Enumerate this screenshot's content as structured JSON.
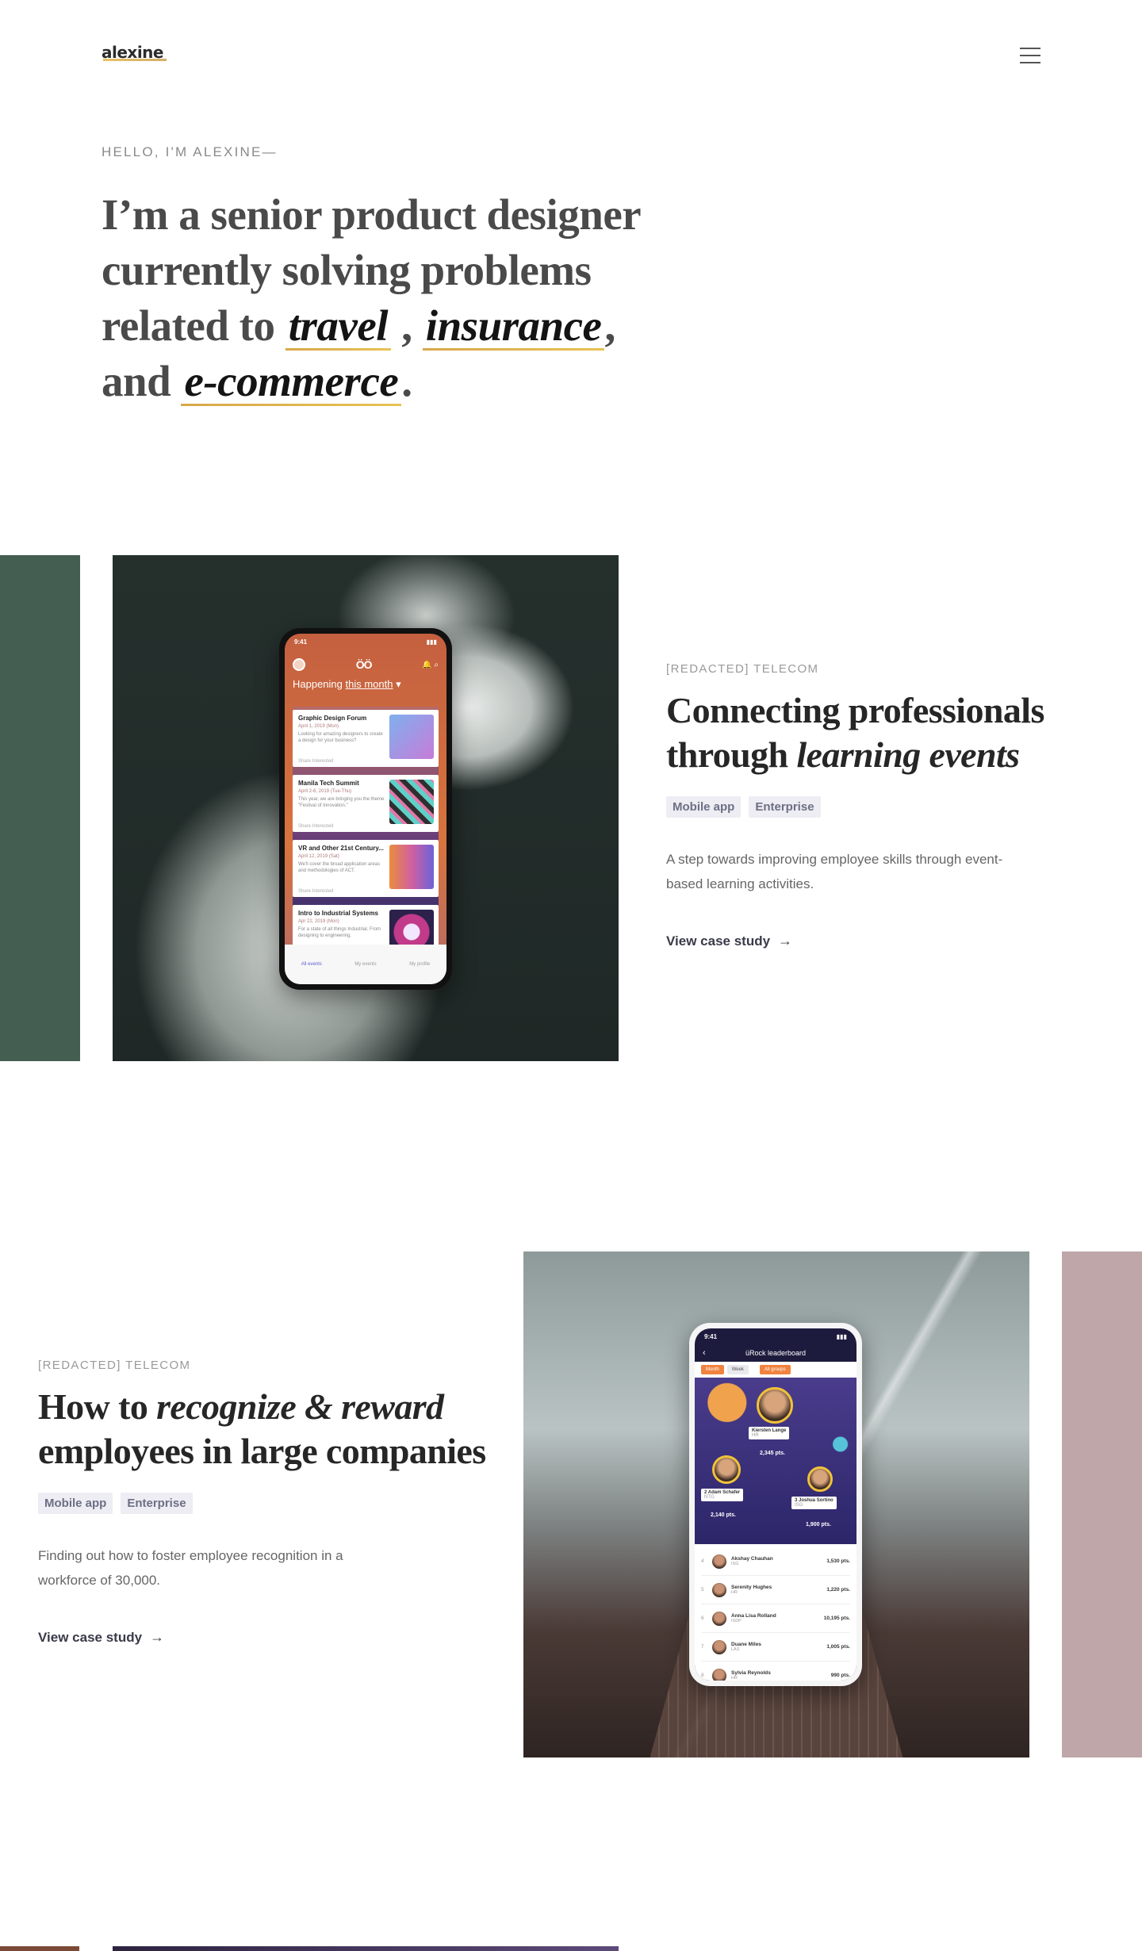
{
  "header": {
    "logo": "alexine",
    "menu_icon": "hamburger-menu-icon"
  },
  "hero": {
    "eyebrow": "HELLO, I'M ALEXINE—",
    "line1": "I’m a senior product designer",
    "line2": "currently solving problems",
    "line3_prefix": "related to ",
    "kw1": "travel",
    "sep1": " , ",
    "kw2": "insurance",
    "sep2": ",",
    "line4_prefix": "and ",
    "kw3": "e-commerce",
    "end": "."
  },
  "cases": [
    {
      "company": "[REDACTED] TELECOM",
      "title_line1": "Connecting professionals",
      "title_line2_plain": "through ",
      "title_line2_em": "learning events",
      "tags": [
        "Mobile app",
        "Enterprise"
      ],
      "description": "A step towards improving employee skills through event-based learning activities.",
      "cta": "View case study",
      "side_color": "#445e52",
      "phone": {
        "time": "9:41",
        "brand": "ÖÖ",
        "heading_prefix": "Happening ",
        "heading_filter": "this month",
        "events": [
          {
            "title": "Graphic Design Forum",
            "meta": "April 1, 2019 (Mon)",
            "text": "Looking for amazing designers to create a design for your business?"
          },
          {
            "title": "Manila Tech Summit",
            "meta": "April 2-6, 2019 (Tue-Thu)",
            "text": "This year, we are bringing you the theme \"Festival of Innovation.\""
          },
          {
            "title": "VR and Other 21st Century...",
            "meta": "April 12, 2019 (Sat)",
            "text": "We'll cover the broad application areas and methodologies of ACT."
          },
          {
            "title": "Intro to Industrial Systems",
            "meta": "Apr 22, 2019 (Mon)",
            "text": "For a state of all things Industrial. From designing to engineering."
          }
        ],
        "actions": "Share    Interested",
        "tabs": [
          "All events",
          "My events",
          "My profile"
        ]
      }
    },
    {
      "company": "[REDACTED] TELECOM",
      "title_line1_plain": "How to ",
      "title_line1_em": "recognize & reward",
      "title_line2": "employees in large companies",
      "tags": [
        "Mobile app",
        "Enterprise"
      ],
      "description_line1": "Finding out how to foster employee recognition in a",
      "description_line2": "workforce of 30,000.",
      "cta": "View case study",
      "side_color": "#bfa6a8",
      "phone": {
        "time": "9:41",
        "title": "üRock leaderboard",
        "filters": [
          "Month",
          "Week",
          "All groups"
        ],
        "podium": [
          {
            "name": "Kiersten Lange",
            "group": "HR",
            "pts": "2,345 pts."
          },
          {
            "name": "Adam Schafer",
            "group": "NTG",
            "pts": "2,140 pts.",
            "rank": "2"
          },
          {
            "name": "Joshua Sortino",
            "group": "ISG",
            "pts": "1,900 pts.",
            "rank": "3"
          }
        ],
        "rows": [
          {
            "rank": "4",
            "name": "Akshay Chauhan",
            "group": "ISG",
            "pts": "1,530 pts."
          },
          {
            "rank": "5",
            "name": "Serenity Hughes",
            "group": "HR",
            "pts": "1,220 pts."
          },
          {
            "rank": "6",
            "name": "Anna Lisa Rolland",
            "group": "ISDP",
            "pts": "10,195 pts."
          },
          {
            "rank": "7",
            "name": "Duane Miles",
            "group": "LAS",
            "pts": "1,005 pts."
          },
          {
            "rank": "8",
            "name": "Sylvia Reynolds",
            "group": "HR",
            "pts": "990 pts."
          }
        ]
      }
    }
  ]
}
